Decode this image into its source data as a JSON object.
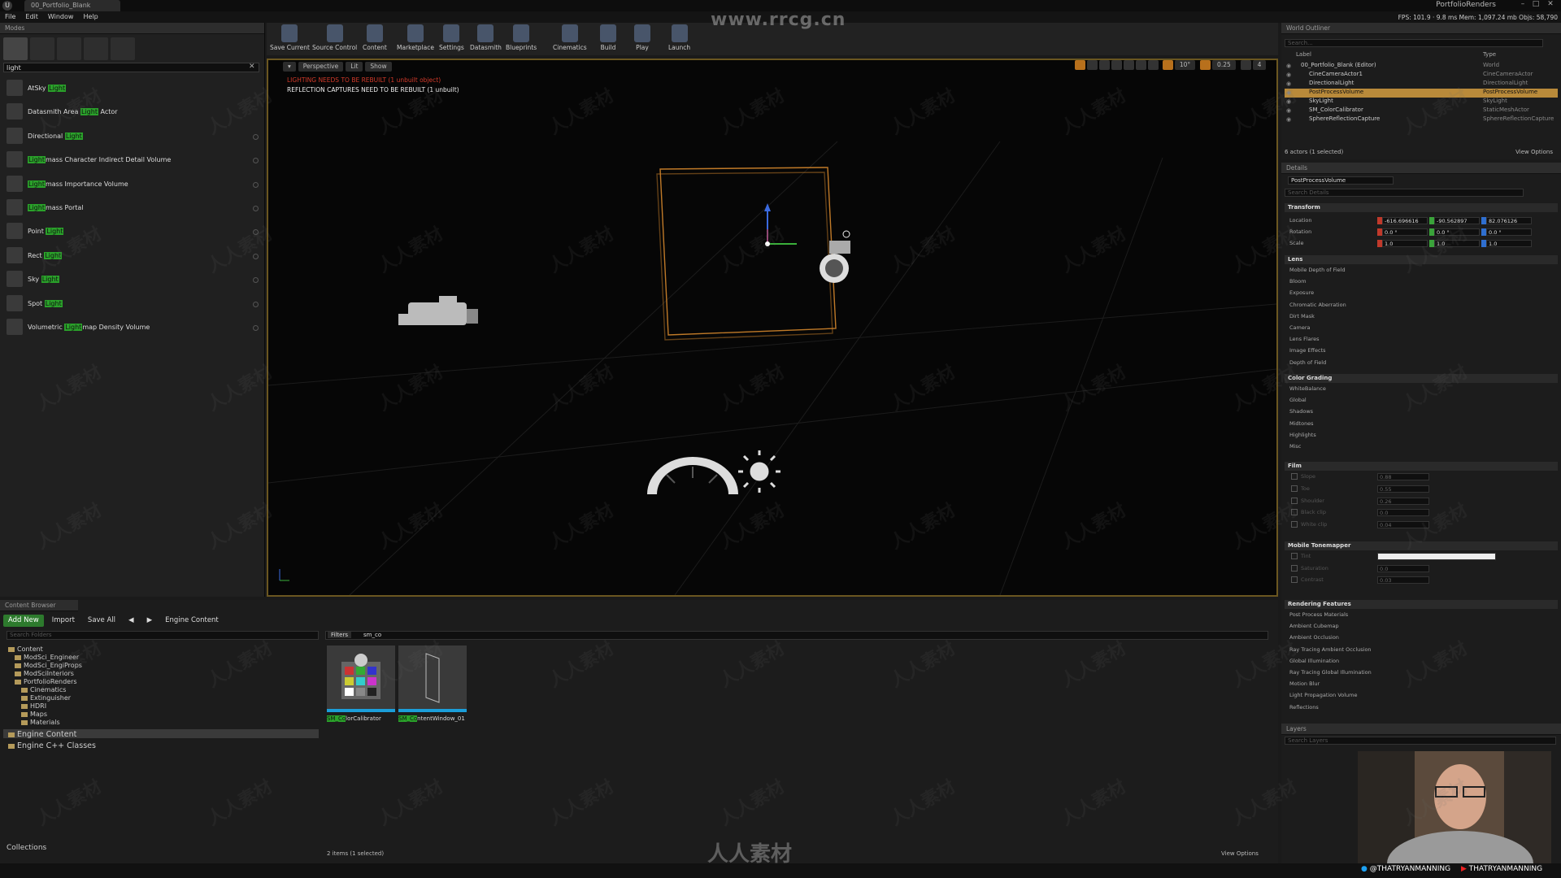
{
  "window": {
    "tab_label": "00_Portfolio_Blank",
    "logo": "U",
    "project_name": "PortfolioRenders",
    "controls": [
      "–",
      "□",
      "✕"
    ]
  },
  "menu": [
    "File",
    "Edit",
    "Window",
    "Help"
  ],
  "stats": "FPS: 101.9 · 9.8 ms  Mem: 1,097.24 mb  Objs: 58,790",
  "watermark": {
    "top": "www.rrcg.cn",
    "bottom": "人人素材"
  },
  "modes": {
    "tab": "Modes",
    "search_value": "light",
    "clear": "✕",
    "actors": [
      {
        "pre": "AtSky ",
        "hl": "Light",
        "post": "",
        "icon": "sky-atmosphere-icon"
      },
      {
        "pre": "Datasmith Area ",
        "hl": "Light",
        "post": " Actor",
        "icon": "area-light-icon"
      },
      {
        "pre": "Directional ",
        "hl": "Light",
        "post": "",
        "icon": "directional-light-icon"
      },
      {
        "pre": "",
        "hl": "Light",
        "post": "mass Character Indirect Detail Volume",
        "icon": "lightmass-volume-icon"
      },
      {
        "pre": "",
        "hl": "Light",
        "post": "mass Importance Volume",
        "icon": "lightmass-importance-icon"
      },
      {
        "pre": "",
        "hl": "Light",
        "post": "mass Portal",
        "icon": "lightmass-portal-icon"
      },
      {
        "pre": "Point ",
        "hl": "Light",
        "post": "",
        "icon": "point-light-icon"
      },
      {
        "pre": "Rect ",
        "hl": "Light",
        "post": "",
        "icon": "rect-light-icon"
      },
      {
        "pre": "Sky ",
        "hl": "Light",
        "post": "",
        "icon": "sky-light-icon"
      },
      {
        "pre": "Spot ",
        "hl": "Light",
        "post": "",
        "icon": "spot-light-icon"
      },
      {
        "pre": "Volumetric ",
        "hl": "Light",
        "post": "map Density Volume",
        "icon": "volumetric-lightmap-icon"
      }
    ]
  },
  "toolbar": {
    "buttons": [
      "Save Current",
      "Source Control",
      "Content",
      "Marketplace",
      "Settings",
      "Datasmith",
      "Blueprints",
      "Cinematics",
      "Build",
      "Play",
      "Launch"
    ]
  },
  "viewport": {
    "mode": "Perspective",
    "lit": "Lit",
    "show": "Show",
    "warning": "LIGHTING NEEDS TO BE REBUILT (1 unbuilt object)",
    "reflection": "REFLECTION CAPTURES NEED TO BE REBUILT (1 unbuilt)",
    "angle": "10°",
    "scale": "0.25",
    "speed": "4"
  },
  "outliner": {
    "tab": "World Outliner",
    "search_placeholder": "Search...",
    "col_label": "Label",
    "col_type": "Type",
    "rows": [
      {
        "name": "00_Portfolio_Blank (Editor)",
        "type": "World",
        "indent": 0,
        "selected": false
      },
      {
        "name": "CineCameraActor1",
        "type": "CineCameraActor",
        "indent": 1,
        "selected": false
      },
      {
        "name": "DirectionalLight",
        "type": "DirectionalLight",
        "indent": 1,
        "selected": false
      },
      {
        "name": "PostProcessVolume",
        "type": "PostProcessVolume",
        "indent": 1,
        "selected": true
      },
      {
        "name": "SkyLight",
        "type": "SkyLight",
        "indent": 1,
        "selected": false
      },
      {
        "name": "SM_ColorCalibrator",
        "type": "StaticMeshActor",
        "indent": 1,
        "selected": false
      },
      {
        "name": "SphereReflectionCapture",
        "type": "SphereReflectionCapture",
        "indent": 1,
        "selected": false
      }
    ],
    "footer": "6 actors (1 selected)",
    "view_options": "View Options"
  },
  "details": {
    "tab": "Details",
    "object_name": "PostProcessVolume",
    "search_placeholder": "Search Details",
    "transform_title": "Transform",
    "location_label": "Location",
    "rotation_label": "Rotation",
    "scale_label": "Scale",
    "location": [
      "-616.696616",
      "-90.562897",
      "82.076126"
    ],
    "rotation": [
      "0.0 °",
      "0.0 °",
      "0.0 °"
    ],
    "scale": [
      "1.0",
      "1.0",
      "1.0"
    ],
    "lens_title": "Lens",
    "lens_items": [
      "Mobile Depth of Field",
      "Bloom",
      "Exposure",
      "Chromatic Aberration",
      "Dirt Mask",
      "Camera",
      "Lens Flares",
      "Image Effects",
      "Depth of Field"
    ],
    "color_title": "Color Grading",
    "color_items": [
      "WhiteBalance",
      "Global",
      "Shadows",
      "Midtones",
      "Highlights",
      "Misc"
    ],
    "film_title": "Film",
    "film_items": [
      {
        "label": "Slope",
        "value": "0.88"
      },
      {
        "label": "Toe",
        "value": "0.55"
      },
      {
        "label": "Shoulder",
        "value": "0.26"
      },
      {
        "label": "Black clip",
        "value": "0.0"
      },
      {
        "label": "White clip",
        "value": "0.04"
      }
    ],
    "tonemapper_title": "Mobile Tonemapper",
    "tonemapper_items": [
      {
        "label": "Tint",
        "value": ""
      },
      {
        "label": "Saturation",
        "value": "0.0"
      },
      {
        "label": "Contrast",
        "value": "0.03"
      }
    ],
    "rendering_title": "Rendering Features",
    "rendering_items": [
      "Post Process Materials",
      "Ambient Cubemap",
      "Ambient Occlusion",
      "Ray Tracing Ambient Occlusion",
      "Global Illumination",
      "Ray Tracing Global Illumination",
      "Motion Blur",
      "Light Propagation Volume",
      "Reflections"
    ]
  },
  "layers": {
    "tab": "Layers",
    "search_placeholder": "Search Layers"
  },
  "content_browser": {
    "tab": "Content Browser",
    "add_new": "Add New",
    "import": "Import",
    "save_all": "Save All",
    "path": "Engine Content",
    "folder_search_placeholder": "Search Folders",
    "filters": "Filters",
    "filter_value": "sm_co",
    "tree": [
      {
        "label": "Content",
        "level": 0
      },
      {
        "label": "ModSci_Engineer",
        "level": 1
      },
      {
        "label": "ModSci_EngiProps",
        "level": 1
      },
      {
        "label": "ModSciInteriors",
        "level": 1
      },
      {
        "label": "PortfolioRenders",
        "level": 1
      },
      {
        "label": "Cinematics",
        "level": 2
      },
      {
        "label": "Extinguisher",
        "level": 2
      },
      {
        "label": "HDRI",
        "level": 2
      },
      {
        "label": "Maps",
        "level": 2
      },
      {
        "label": "Materials",
        "level": 2
      },
      {
        "label": "Engine Content",
        "level": 0
      },
      {
        "label": "Engine C++ Classes",
        "level": 0
      }
    ],
    "assets": [
      {
        "hl": "SM_Co",
        "rest": "lorCalibrator"
      },
      {
        "hl": "SM_Co",
        "rest": "ntentWindow_01"
      }
    ],
    "count": "2 items (1 selected)",
    "view_options": "View Options",
    "collections": "Collections"
  },
  "social": {
    "twitter": "@THATRYANMANNING",
    "youtube": "THATRYANMANNING"
  },
  "colors": {
    "accent_green": "#2aa12a",
    "selection": "#b98a3a",
    "viewport_border": "#6a5620"
  }
}
